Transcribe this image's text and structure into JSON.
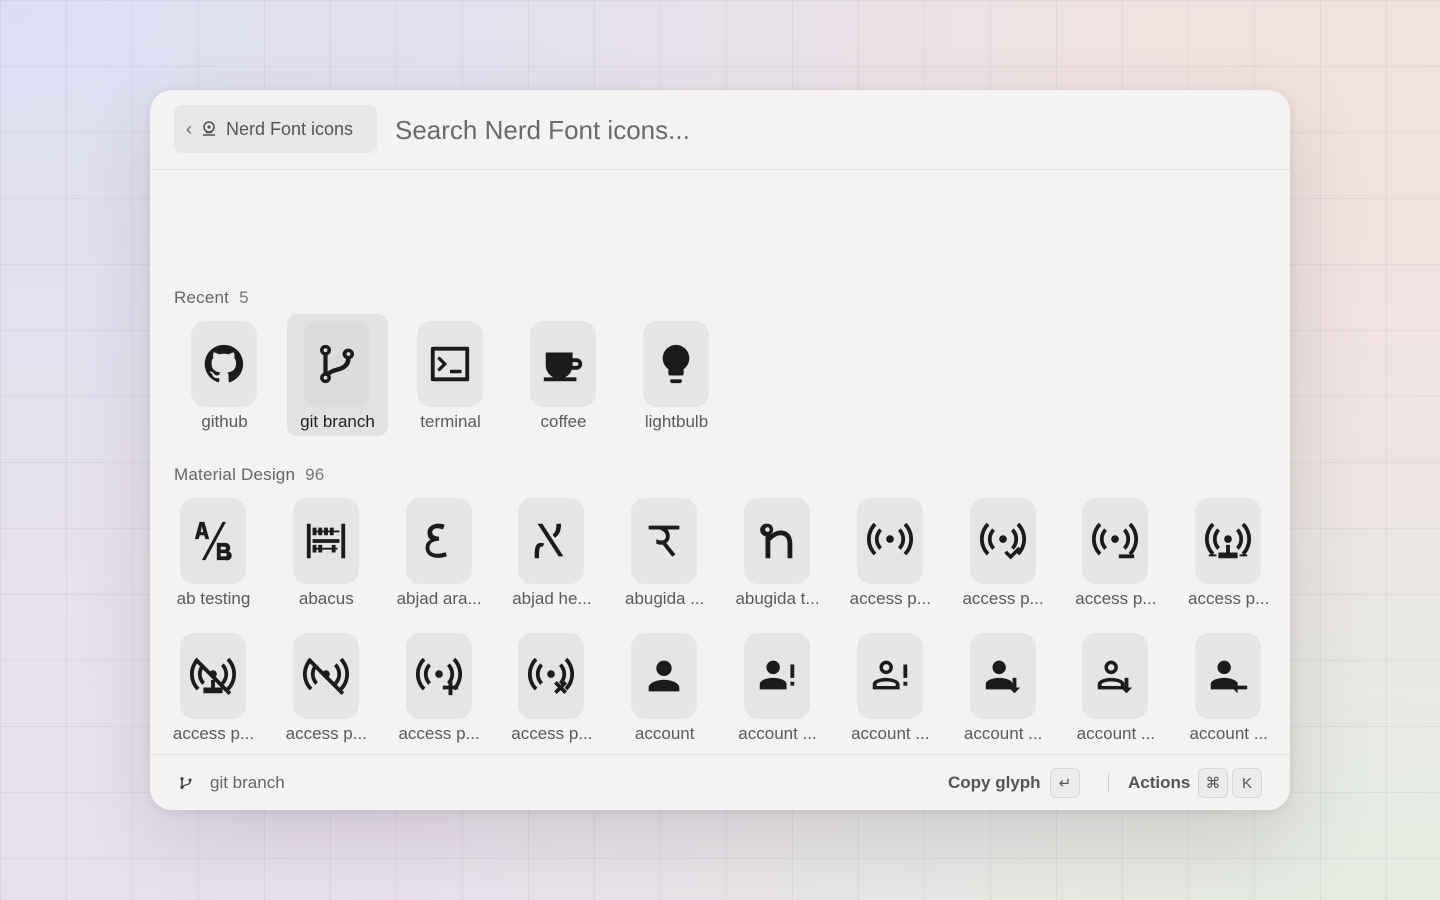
{
  "header": {
    "back_icon": "chevron-left-icon",
    "extension_icon": "nerd-font-icon",
    "back_label": "Nerd Font icons",
    "search_placeholder": "Search Nerd Font icons..."
  },
  "sections": [
    {
      "title": "Recent",
      "count": "5",
      "items": [
        {
          "label": "github",
          "icon": "github-icon"
        },
        {
          "label": "git branch",
          "icon": "git-branch-icon",
          "selected": true
        },
        {
          "label": "terminal",
          "icon": "terminal-icon"
        },
        {
          "label": "coffee",
          "icon": "coffee-icon"
        },
        {
          "label": "lightbulb",
          "icon": "lightbulb-icon"
        }
      ]
    },
    {
      "title": "Material Design",
      "count": "96",
      "items": [
        {
          "label": "ab testing",
          "icon": "ab-testing-icon"
        },
        {
          "label": "abacus",
          "icon": "abacus-icon"
        },
        {
          "label": "abjad ara...",
          "icon": "abjad-arabic-icon"
        },
        {
          "label": "abjad he...",
          "icon": "abjad-hebrew-icon"
        },
        {
          "label": "abugida ...",
          "icon": "abugida-devanagari-icon"
        },
        {
          "label": "abugida t...",
          "icon": "abugida-thai-icon"
        },
        {
          "label": "access p...",
          "icon": "access-point-icon"
        },
        {
          "label": "access p...",
          "icon": "access-point-check-icon"
        },
        {
          "label": "access p...",
          "icon": "access-point-minus-icon"
        },
        {
          "label": "access p...",
          "icon": "access-point-network-icon"
        },
        {
          "label": "access p...",
          "icon": "access-point-network-off-icon"
        },
        {
          "label": "access p...",
          "icon": "access-point-off-icon"
        },
        {
          "label": "access p...",
          "icon": "access-point-plus-icon"
        },
        {
          "label": "access p...",
          "icon": "access-point-remove-icon"
        },
        {
          "label": "account",
          "icon": "account-icon"
        },
        {
          "label": "account ...",
          "icon": "account-alert-icon"
        },
        {
          "label": "account ...",
          "icon": "account-alert-outline-icon"
        },
        {
          "label": "account ...",
          "icon": "account-arrow-down-icon"
        },
        {
          "label": "account ...",
          "icon": "account-arrow-down-outline-icon"
        },
        {
          "label": "account ...",
          "icon": "account-arrow-left-icon"
        },
        {
          "label": "",
          "icon": "account-arrow-left-outline-icon"
        },
        {
          "label": "",
          "icon": "account-arrow-right-icon"
        },
        {
          "label": "",
          "icon": "account-arrow-right-outline-icon"
        },
        {
          "label": "",
          "icon": "account-arrow-up-icon"
        },
        {
          "label": "",
          "icon": "account-arrow-up-outline-icon"
        },
        {
          "label": "",
          "icon": "account-box-icon"
        },
        {
          "label": "",
          "icon": "account-box-multiple-icon"
        },
        {
          "label": "",
          "icon": "account-box-multiple-outline-icon"
        },
        {
          "label": "",
          "icon": "account-box-outline-icon"
        },
        {
          "label": "",
          "icon": "account-cancel-icon"
        }
      ]
    }
  ],
  "footer": {
    "selected_icon": "git-branch-icon",
    "selected_name": "git branch",
    "primary_action": "Copy glyph",
    "primary_key": "↵",
    "secondary_action": "Actions",
    "secondary_keys": [
      "⌘",
      "K"
    ]
  }
}
